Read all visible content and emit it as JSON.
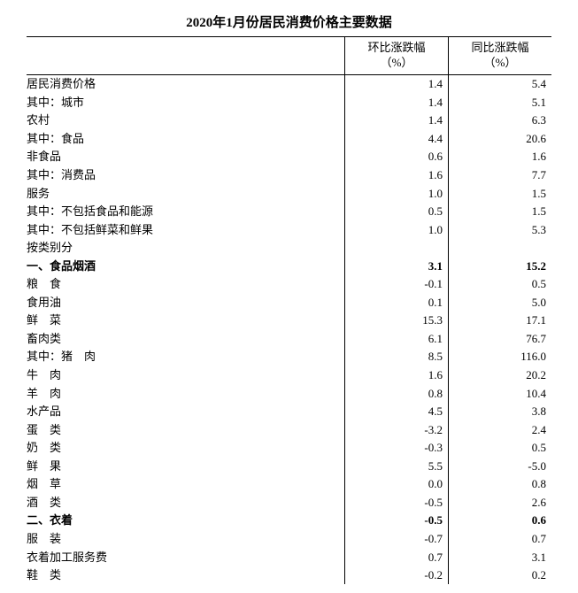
{
  "title": "2020年1月份居民消费价格主要数据",
  "headers": {
    "blank": "",
    "mom": "环比涨跌幅\n（%）",
    "yoy": "同比涨跌幅\n（%）"
  },
  "rows": [
    {
      "label": "居民消费价格",
      "indent": 0,
      "bold": false,
      "mom": "1.4",
      "yoy": "5.4"
    },
    {
      "label": "其中：城市",
      "indent": 1,
      "bold": false,
      "mom": "1.4",
      "yoy": "5.1"
    },
    {
      "label": "农村",
      "indent": 2,
      "bold": false,
      "mom": "1.4",
      "yoy": "6.3"
    },
    {
      "label": "其中：食品",
      "indent": 1,
      "bold": false,
      "mom": "4.4",
      "yoy": "20.6"
    },
    {
      "label": "非食品",
      "indent": 2,
      "bold": false,
      "mom": "0.6",
      "yoy": "1.6"
    },
    {
      "label": "其中：消费品",
      "indent": 1,
      "bold": false,
      "mom": "1.6",
      "yoy": "7.7"
    },
    {
      "label": "服务",
      "indent": 2,
      "bold": false,
      "mom": "1.0",
      "yoy": "1.5"
    },
    {
      "label": "其中：不包括食品和能源",
      "indent": 1,
      "bold": false,
      "mom": "0.5",
      "yoy": "1.5"
    },
    {
      "label": "其中：不包括鲜菜和鲜果",
      "indent": 1,
      "bold": false,
      "mom": "1.0",
      "yoy": "5.3"
    },
    {
      "label": "按类别分",
      "indent": 0,
      "bold": false,
      "mom": "",
      "yoy": ""
    },
    {
      "label": "一、食品烟酒",
      "indent": 0,
      "bold": true,
      "mom": "3.1",
      "yoy": "15.2"
    },
    {
      "label": "粮　食",
      "indent": 1,
      "bold": false,
      "mom": "-0.1",
      "yoy": "0.5"
    },
    {
      "label": "食用油",
      "indent": 1,
      "bold": false,
      "mom": "0.1",
      "yoy": "5.0"
    },
    {
      "label": "鲜　菜",
      "indent": 1,
      "bold": false,
      "mom": "15.3",
      "yoy": "17.1"
    },
    {
      "label": "畜肉类",
      "indent": 1,
      "bold": false,
      "mom": "6.1",
      "yoy": "76.7"
    },
    {
      "label": "其中：猪　肉",
      "indent": 2,
      "bold": false,
      "mom": "8.5",
      "yoy": "116.0"
    },
    {
      "label": "牛　肉",
      "indent": 3,
      "bold": false,
      "mom": "1.6",
      "yoy": "20.2"
    },
    {
      "label": "羊　肉",
      "indent": 3,
      "bold": false,
      "mom": "0.8",
      "yoy": "10.4"
    },
    {
      "label": "水产品",
      "indent": 1,
      "bold": false,
      "mom": "4.5",
      "yoy": "3.8"
    },
    {
      "label": "蛋　类",
      "indent": 1,
      "bold": false,
      "mom": "-3.2",
      "yoy": "2.4"
    },
    {
      "label": "奶　类",
      "indent": 1,
      "bold": false,
      "mom": "-0.3",
      "yoy": "0.5"
    },
    {
      "label": "鲜　果",
      "indent": 1,
      "bold": false,
      "mom": "5.5",
      "yoy": "-5.0"
    },
    {
      "label": "烟　草",
      "indent": 1,
      "bold": false,
      "mom": "0.0",
      "yoy": "0.8"
    },
    {
      "label": "酒　类",
      "indent": 1,
      "bold": false,
      "mom": "-0.5",
      "yoy": "2.6"
    },
    {
      "label": "二、衣着",
      "indent": 0,
      "bold": true,
      "mom": "-0.5",
      "yoy": "0.6"
    },
    {
      "label": "服　装",
      "indent": 1,
      "bold": false,
      "mom": "-0.7",
      "yoy": "0.7"
    },
    {
      "label": "衣着加工服务费",
      "indent": 1,
      "bold": false,
      "mom": "0.7",
      "yoy": "3.1"
    },
    {
      "label": "鞋　类",
      "indent": 1,
      "bold": false,
      "mom": "-0.2",
      "yoy": "0.2"
    }
  ]
}
